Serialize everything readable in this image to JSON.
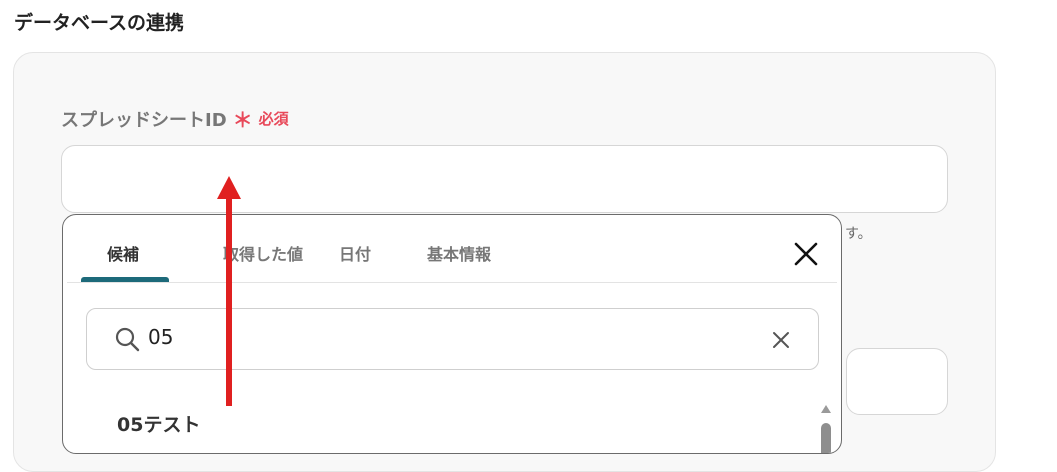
{
  "section": {
    "title": "データベースの連携"
  },
  "field": {
    "label": "スプレッドシートID",
    "required_mark": "＊",
    "required_text": "必須",
    "value": "",
    "help_fragment": "す。"
  },
  "popup": {
    "tabs": [
      {
        "label": "候補",
        "active": true
      },
      {
        "label": "取得した値",
        "active": false
      },
      {
        "label": "日付",
        "active": false
      },
      {
        "label": "基本情報",
        "active": false
      }
    ],
    "search": {
      "value": "05"
    },
    "results": [
      {
        "label": "05テスト"
      }
    ]
  },
  "colors": {
    "required": "#e8495a",
    "tab_indicator": "#1d6a7a",
    "annotation_arrow": "#e02020"
  },
  "icons": {
    "close": "close-icon",
    "search": "search-icon",
    "clear": "clear-icon",
    "scroll_up": "scroll-up-icon"
  }
}
